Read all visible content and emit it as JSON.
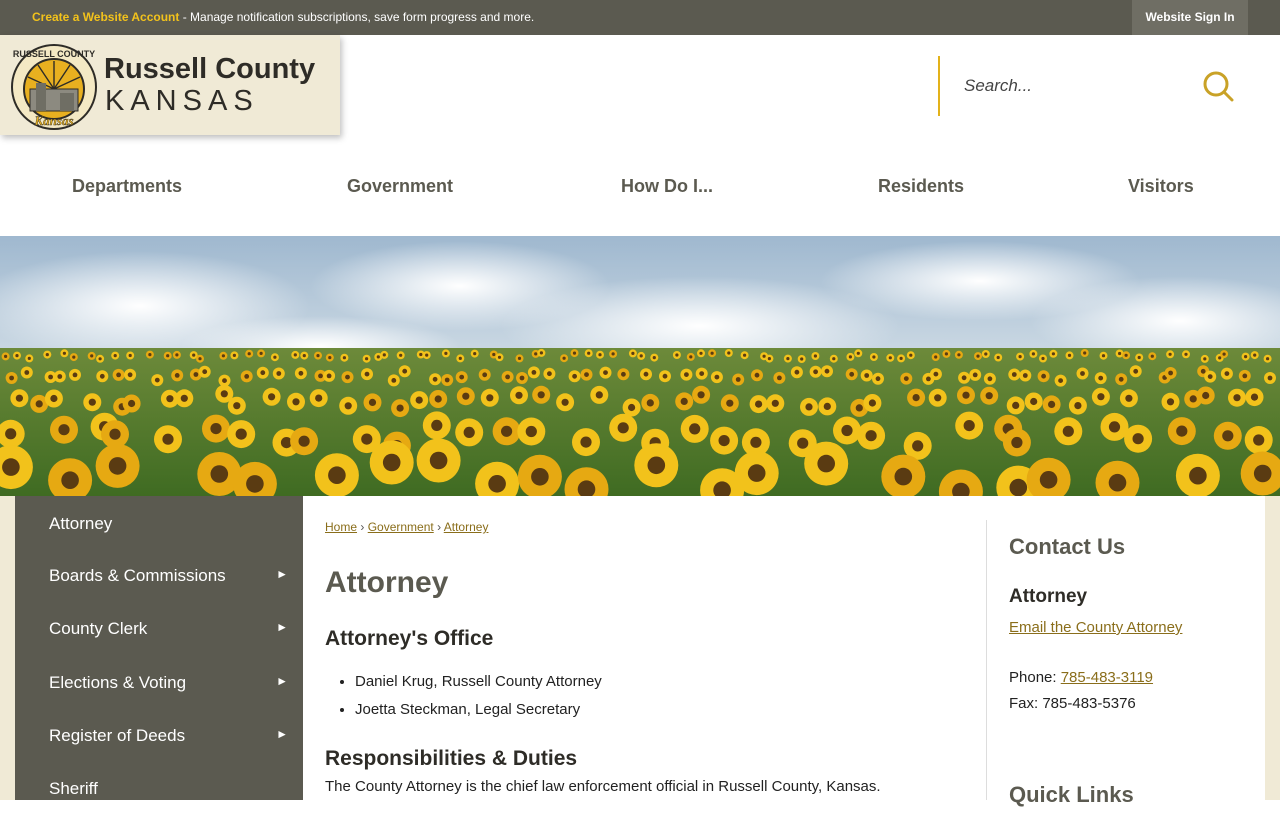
{
  "topbar": {
    "account_link": "Create a Website Account",
    "message": " - Manage notification subscriptions, save form progress and more.",
    "signin": "Website Sign In"
  },
  "logo": {
    "name": "Russell County",
    "state": "KANSAS",
    "seal_top_text": "RUSSELL COUNTY",
    "seal_script_text": "Kansas"
  },
  "search": {
    "placeholder": "Search...",
    "icon": "search-icon"
  },
  "nav": {
    "items": [
      "Departments",
      "Government",
      "How Do I...",
      "Residents",
      "Visitors"
    ]
  },
  "sidebar": {
    "items": [
      {
        "label": "Attorney",
        "has_submenu": false
      },
      {
        "label": "Boards & Commissions",
        "has_submenu": true
      },
      {
        "label": "County Clerk",
        "has_submenu": true
      },
      {
        "label": "Elections & Voting",
        "has_submenu": true
      },
      {
        "label": "Register of Deeds",
        "has_submenu": true
      },
      {
        "label": "Sheriff",
        "has_submenu": false
      }
    ],
    "arrow": "►"
  },
  "breadcrumb": {
    "items": [
      "Home",
      "Government",
      "Attorney"
    ],
    "separator": "›"
  },
  "main": {
    "title": "Attorney",
    "office_heading": "Attorney's Office",
    "staff": [
      "Daniel Krug, Russell County Attorney",
      "Joetta Steckman, Legal Secretary"
    ],
    "duties_heading": "Responsibilities & Duties",
    "duties_text": "The County Attorney is the chief law enforcement official in Russell County, Kansas."
  },
  "contact": {
    "title": "Contact Us",
    "dept": "Attorney",
    "email_link": "Email the County Attorney",
    "phone_label": "Phone: ",
    "phone": "785-483-3119",
    "fax_label": "Fax: ",
    "fax": "785-483-5376",
    "fax_line": "Fax: 785-483-5376"
  },
  "quick_links": {
    "title": "Quick Links"
  },
  "colors": {
    "topbar": "#5b5a50",
    "accent_gold": "#f2c21b",
    "link": "#8a6e1b",
    "logo_bg": "#f0ead6",
    "sidebar": "#5b5a50"
  }
}
